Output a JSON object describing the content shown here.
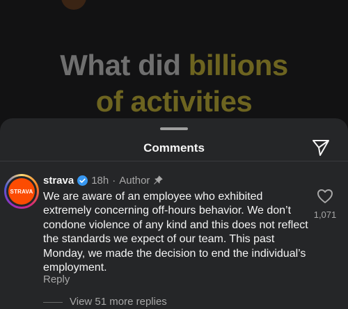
{
  "background": {
    "headline_line1_part1": "What did",
    "headline_line1_part2": "billions",
    "headline_line2": "of activities"
  },
  "sheet": {
    "title": "Comments",
    "share_icon": "send-icon"
  },
  "comment": {
    "avatar_text": "STRAVA",
    "username": "strava",
    "verified_icon": "verified-badge-icon",
    "time": "18h",
    "separator": "·",
    "author_label": "Author",
    "pin_icon": "pin-icon",
    "text": "We are aware of an employee who exhibited extremely concerning off-hours behavior. We don’t condone violence of any kind and this does not reflect the standards we expect of our team. This past Monday, we made the decision to end the individual’s employment.",
    "reply_label": "Reply",
    "like_icon": "heart-icon",
    "like_count": "1,071",
    "view_replies": "View 51 more replies"
  },
  "colors": {
    "accent_gold": "#6d6420",
    "strava_orange": "#fc4c02",
    "verified_blue": "#3797f0"
  }
}
